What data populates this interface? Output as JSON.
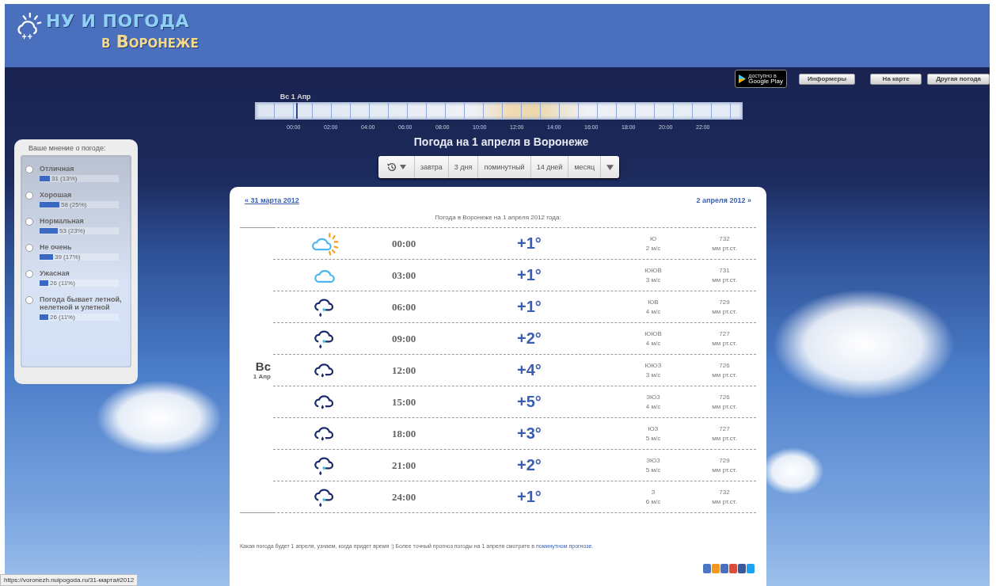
{
  "logo": {
    "title": "НУ И ПОГОДА",
    "subtitle": "в Воронеже"
  },
  "top_buttons": {
    "store_badge": {
      "small": "доступно в",
      "name": "Google Play"
    },
    "buttons": [
      "Информеры",
      "На карте",
      "Другая погода"
    ]
  },
  "timeline": {
    "date_label": "Вс 1 Апр",
    "hours": [
      "00:00",
      "02:00",
      "04:00",
      "06:00",
      "08:00",
      "10:00",
      "12:00",
      "14:00",
      "16:00",
      "18:00",
      "20:00",
      "22:00"
    ],
    "level": 0.083
  },
  "page_title": "Погода на 1 апреля в Воронеже",
  "period_menu": {
    "items": [
      "завтра",
      "3 дня",
      "поминутный",
      "14 дней",
      "месяц"
    ]
  },
  "poll": {
    "title": "Ваше мнение о погоде:",
    "options": [
      {
        "label": "Отличная",
        "result": "31 (13%)",
        "level": 0.13,
        "selected": false
      },
      {
        "label": "Хорошая",
        "result": "58 (25%)",
        "level": 0.25,
        "selected": false
      },
      {
        "label": "Нормальная",
        "result": "53 (23%)",
        "level": 0.23,
        "selected": false
      },
      {
        "label": "Не очень",
        "result": "39 (17%)",
        "level": 0.17,
        "selected": false
      },
      {
        "label": "Ужасная",
        "result": "26 (11%)",
        "level": 0.11,
        "selected": false
      },
      {
        "label": "Погода бывает летной, нелетной и улетной",
        "result": "26 (11%)",
        "level": 0.11,
        "selected": false
      }
    ]
  },
  "forecast": {
    "prev_link": "« 31 марта 2012",
    "next_link": "2 апреля 2012 »",
    "caption": "Погода в Воронеже на 1 апреля 2012 года:",
    "day": {
      "weekday": "Вс",
      "date": "1 Апр"
    },
    "rows": [
      {
        "kind": "sun-cloud",
        "time": "00:00",
        "temp": "+1°",
        "wind_dir": "Ю",
        "wind_speed": "2 м/с",
        "pressure": "732",
        "pressure_unit": "мм рт.ст."
      },
      {
        "kind": "cloud",
        "time": "03:00",
        "temp": "+1°",
        "wind_dir": "ЮЮВ",
        "wind_speed": "3 м/с",
        "pressure": "731",
        "pressure_unit": "мм рт.ст."
      },
      {
        "kind": "rain-snow",
        "time": "06:00",
        "temp": "+1°",
        "wind_dir": "ЮВ",
        "wind_speed": "4 м/с",
        "pressure": "729",
        "pressure_unit": "мм рт.ст."
      },
      {
        "kind": "rain-snow",
        "time": "09:00",
        "temp": "+2°",
        "wind_dir": "ЮЮВ",
        "wind_speed": "4 м/с",
        "pressure": "727",
        "pressure_unit": "мм рт.ст."
      },
      {
        "kind": "rain",
        "time": "12:00",
        "temp": "+4°",
        "wind_dir": "ЮЮЗ",
        "wind_speed": "3 м/с",
        "pressure": "726",
        "pressure_unit": "мм рт.ст."
      },
      {
        "kind": "rain",
        "time": "15:00",
        "temp": "+5°",
        "wind_dir": "ЗЮЗ",
        "wind_speed": "4 м/с",
        "pressure": "726",
        "pressure_unit": "мм рт.ст."
      },
      {
        "kind": "rain",
        "time": "18:00",
        "temp": "+3°",
        "wind_dir": "ЮЗ",
        "wind_speed": "5 м/с",
        "pressure": "727",
        "pressure_unit": "мм рт.ст."
      },
      {
        "kind": "rain-snow",
        "time": "21:00",
        "temp": "+2°",
        "wind_dir": "ЗЮЗ",
        "wind_speed": "5 м/с",
        "pressure": "729",
        "pressure_unit": "мм рт.ст."
      },
      {
        "kind": "rain-snow",
        "time": "24:00",
        "temp": "+1°",
        "wind_dir": "З",
        "wind_speed": "6 м/с",
        "pressure": "732",
        "pressure_unit": "мм рт.ст."
      }
    ],
    "note": "Какая погода будет 1 апреля, узнаем, когда придет время :) Более точный прогноз погоды на 1 апреля смотрите в ",
    "note_link": "поминутном прогнозе",
    "note_end": "."
  },
  "status_bar": {
    "url": "https://voronezh.nuipogoda.ru/31-марта#2012"
  }
}
